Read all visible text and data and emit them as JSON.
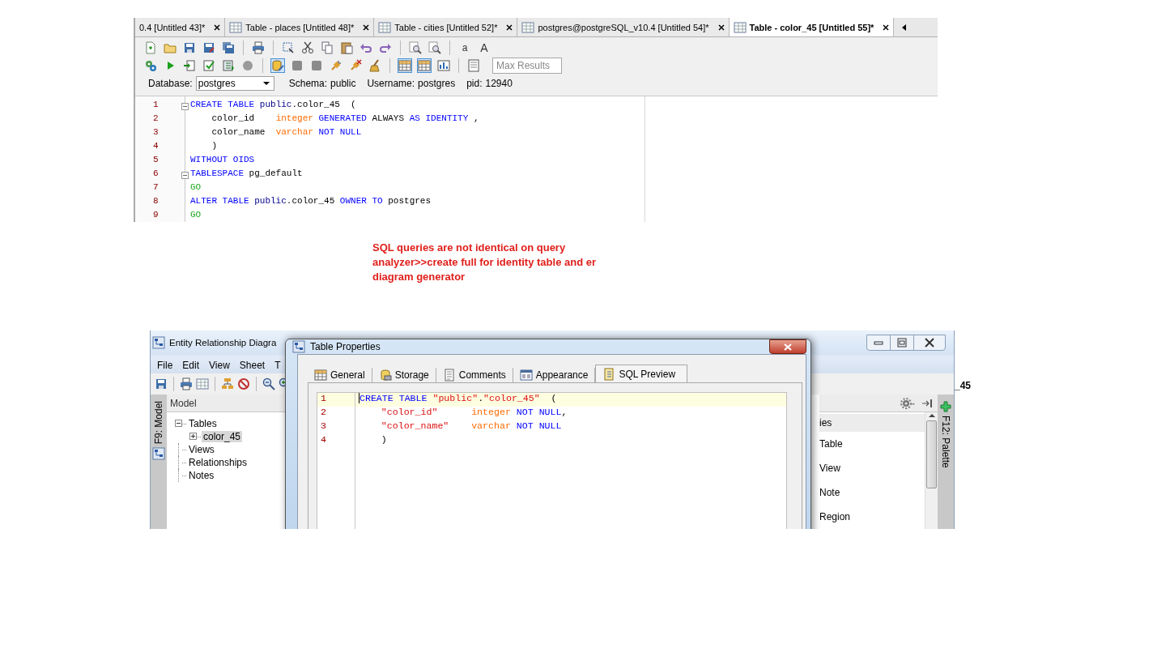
{
  "editor_window": {
    "tabs": [
      {
        "label": "0.4 [Untitled 43]*",
        "selected": false,
        "icon": false
      },
      {
        "label": "Table - places [Untitled 48]*",
        "selected": false,
        "icon": true
      },
      {
        "label": "Table - cities [Untitled 52]*",
        "selected": false,
        "icon": true
      },
      {
        "label": "postgres@postgreSQL_v10.4 [Untitled 54]*",
        "selected": false,
        "icon": true
      },
      {
        "label": "Table - color_45 [Untitled 55]*",
        "selected": true,
        "icon": true
      }
    ],
    "toolbar": {
      "font_buttons": [
        "a",
        "A"
      ],
      "row_2_buttons": [
        {
          "pressed": false
        },
        {
          "pressed": false
        },
        {
          "pressed": false
        },
        {
          "pressed": false
        },
        {
          "pressed": false
        },
        {
          "pressed": false
        },
        {
          "pressed": true
        },
        {
          "pressed": false
        },
        {
          "pressed": false
        },
        {
          "pressed": false
        },
        {
          "pressed": false
        },
        {
          "pressed": false
        },
        {
          "pressed": true
        },
        {
          "pressed": true
        },
        {
          "pressed": false
        },
        {
          "pressed": false
        }
      ],
      "max_results_placeholder": "Max Results"
    },
    "connection": {
      "database_label": "Database:",
      "database": "postgres",
      "schema_label": "Schema:",
      "schema": "public",
      "username_label": "Username:",
      "username": "postgres",
      "pid_label": "pid:",
      "pid": "12940"
    },
    "code_lines": [
      {
        "number": "1",
        "foldable": true,
        "tokens": [
          {
            "kind": "keyword",
            "text": "CREATE TABLE "
          },
          {
            "kind": "schema",
            "text": "public"
          },
          {
            "kind": "plain",
            "text": ".color_45  ("
          }
        ]
      },
      {
        "number": "2",
        "foldable": false,
        "tokens": [
          {
            "kind": "plain",
            "text": "    color_id    "
          },
          {
            "kind": "type",
            "text": "integer"
          },
          {
            "kind": "keyword",
            "text": " GENERATED"
          },
          {
            "kind": "plain",
            "text": " ALWAYS "
          },
          {
            "kind": "keyword",
            "text": "AS IDENTITY"
          },
          {
            "kind": "plain",
            "text": " ,"
          }
        ]
      },
      {
        "number": "3",
        "foldable": false,
        "tokens": [
          {
            "kind": "plain",
            "text": "    color_name  "
          },
          {
            "kind": "type",
            "text": "varchar"
          },
          {
            "kind": "keyword",
            "text": " NOT NULL"
          }
        ]
      },
      {
        "number": "4",
        "foldable": false,
        "tokens": [
          {
            "kind": "plain",
            "text": "    )"
          }
        ]
      },
      {
        "number": "5",
        "foldable": false,
        "tokens": [
          {
            "kind": "keyword",
            "text": "WITHOUT OIDS"
          }
        ]
      },
      {
        "number": "6",
        "foldable": true,
        "tokens": [
          {
            "kind": "keyword",
            "text": "TABLESPACE"
          },
          {
            "kind": "plain",
            "text": " pg_default"
          }
        ]
      },
      {
        "number": "7",
        "foldable": false,
        "tokens": [
          {
            "kind": "go",
            "text": "GO"
          }
        ]
      },
      {
        "number": "8",
        "foldable": false,
        "tokens": [
          {
            "kind": "keyword",
            "text": "ALTER TABLE "
          },
          {
            "kind": "schema",
            "text": "public"
          },
          {
            "kind": "plain",
            "text": ".color_45 "
          },
          {
            "kind": "keyword",
            "text": "OWNER TO"
          },
          {
            "kind": "plain",
            "text": " postgres"
          }
        ]
      },
      {
        "number": "9",
        "foldable": false,
        "tokens": [
          {
            "kind": "go",
            "text": "GO"
          }
        ]
      }
    ]
  },
  "annotation": "SQL queries are not identical on query analyzer>>create full for identity table and er diagram generator",
  "erd_window": {
    "title": "Entity Relationship Diagra",
    "menu": [
      "File",
      "Edit",
      "View",
      "Sheet",
      "T"
    ],
    "model_panel": {
      "side_tab": "F9: Model",
      "title": "Model",
      "tree": [
        {
          "label": "Tables",
          "expanded": true,
          "selected": false,
          "children": [
            {
              "label": "color_45",
              "expanded": false,
              "selected": true
            }
          ]
        },
        {
          "label": "Views",
          "selected": false
        },
        {
          "label": "Relationships",
          "selected": false
        },
        {
          "label": "Notes",
          "selected": false
        }
      ]
    },
    "palette": {
      "side_tab": "F12: Palette",
      "header": "ies",
      "items": [
        "Table",
        "View",
        "Note",
        "Region"
      ]
    },
    "background_tab_text": "_45"
  },
  "dialog": {
    "title": "Table Properties",
    "tabs": [
      {
        "label": "General",
        "selected": false
      },
      {
        "label": "Storage",
        "selected": false
      },
      {
        "label": "Comments",
        "selected": false
      },
      {
        "label": "Appearance",
        "selected": false
      },
      {
        "label": "SQL Preview",
        "selected": true
      }
    ],
    "code_lines": [
      {
        "number": "1",
        "current": true,
        "tokens": [
          {
            "kind": "keyword",
            "text": "CREATE TABLE "
          },
          {
            "kind": "string",
            "text": "\"public\""
          },
          {
            "kind": "plain",
            "text": "."
          },
          {
            "kind": "string",
            "text": "\"color_45\""
          },
          {
            "kind": "plain",
            "text": "  ("
          }
        ]
      },
      {
        "number": "2",
        "current": false,
        "tokens": [
          {
            "kind": "string",
            "text": "    \"color_id\"      "
          },
          {
            "kind": "type",
            "text": "integer"
          },
          {
            "kind": "keyword",
            "text": " NOT NULL"
          },
          {
            "kind": "plain",
            "text": ","
          }
        ]
      },
      {
        "number": "3",
        "current": false,
        "tokens": [
          {
            "kind": "string",
            "text": "    \"color_name\"    "
          },
          {
            "kind": "type",
            "text": "varchar"
          },
          {
            "kind": "keyword",
            "text": " NOT NULL"
          }
        ]
      },
      {
        "number": "4",
        "current": false,
        "tokens": [
          {
            "kind": "plain",
            "text": "    )"
          }
        ]
      }
    ]
  }
}
